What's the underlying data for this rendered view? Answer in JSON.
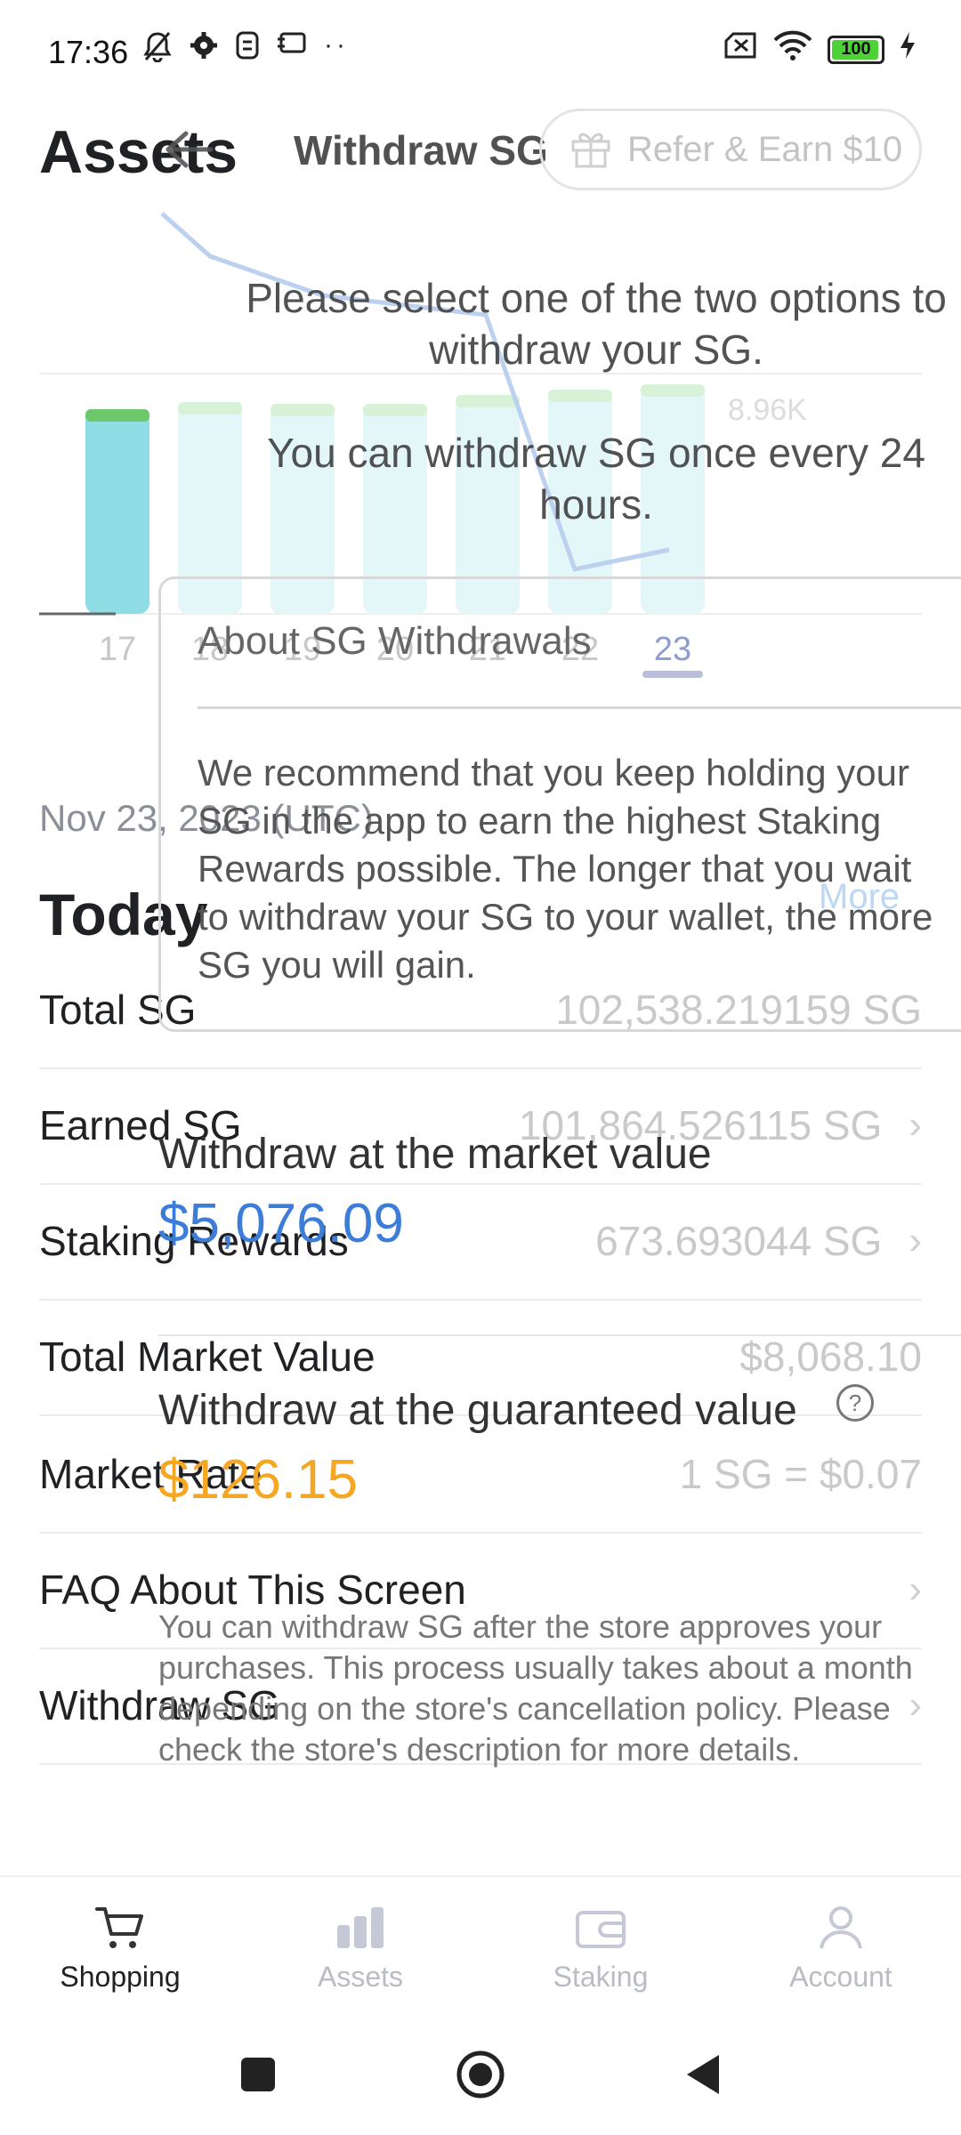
{
  "status_bar": {
    "time": "17:36",
    "battery": "100",
    "left_icons": [
      "bell-off-icon",
      "gear-icon",
      "sim-icon",
      "nfc-icon",
      "more-dots-icon"
    ],
    "right_icons": [
      "no-sim-icon",
      "wifi-icon",
      "battery-icon",
      "charging-icon"
    ]
  },
  "assets": {
    "title": "Assets",
    "chart_data": {
      "type": "bar",
      "categories": [
        "17",
        "18",
        "19",
        "20",
        "21",
        "22",
        "23"
      ],
      "selected": "23",
      "label_max": "8.96K"
    },
    "date_label": "Nov 23, 2023 (UTC)",
    "today": "Today",
    "rows": [
      {
        "label": "Total SG",
        "value": "102,538.219159 SG"
      },
      {
        "label": "Earned SG",
        "value": "101,864.526115 SG"
      },
      {
        "label": "Staking Rewards",
        "value": "673.693044 SG"
      },
      {
        "label": "Total Market Value",
        "value": "$8,068.10"
      },
      {
        "label": "Market Rate",
        "value": "1 SG = $0.07"
      },
      {
        "label": "FAQ About This Screen",
        "value": ""
      },
      {
        "label": "Withdraw SG",
        "value": ""
      }
    ],
    "more_link": "More"
  },
  "bottom_nav": [
    {
      "label": "Shopping",
      "icon": "cart-icon"
    },
    {
      "label": "Assets",
      "icon": "bar-chart-icon"
    },
    {
      "label": "Staking",
      "icon": "wallet-icon"
    },
    {
      "label": "Account",
      "icon": "person-icon"
    }
  ],
  "withdraw": {
    "title": "Withdraw SG",
    "refer_label": "Refer & Earn $10",
    "message1": "Please select one of the two options to withdraw your SG.",
    "message2": "You can withdraw SG once every 24 hours.",
    "about_title": "About SG Withdrawals",
    "about_lines": [
      "We recommend that you keep holding your",
      "SG in the app to earn the highest Staking",
      "Rewards possible. The longer that you wait",
      "to withdraw your SG to your wallet, the more",
      "SG you will gain."
    ],
    "market_label": "Withdraw at the market value",
    "market_value": "$5,076.09",
    "guaranteed_label": "Withdraw at the guaranteed value",
    "guaranteed_value": "$126.15",
    "note_lines": [
      "You can withdraw SG after the store approves your",
      "purchases. This process usually takes about a month",
      "depending on the store's cancellation policy. Please",
      "check the store's description for more details."
    ]
  }
}
